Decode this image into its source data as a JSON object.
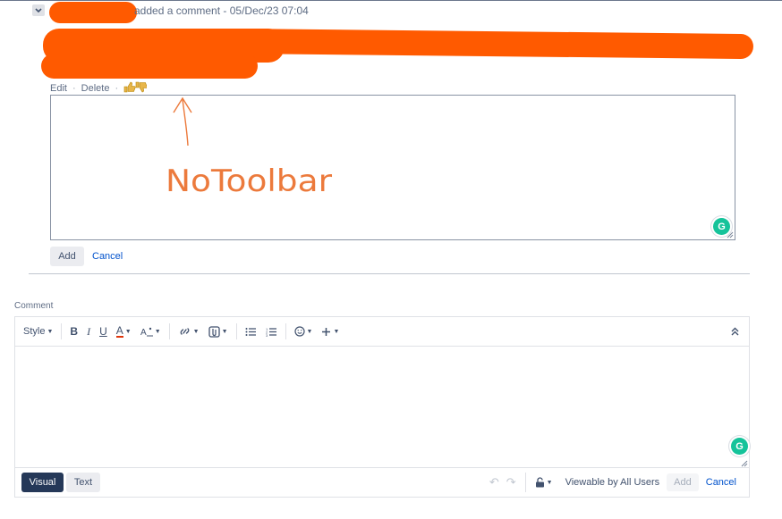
{
  "comment_header": {
    "meta": "added a comment - 05/Dec/23 07:04"
  },
  "comment_actions": {
    "edit": "Edit",
    "delete": "Delete",
    "separator": "·"
  },
  "annotation": {
    "text": "NoToolbar",
    "color": "#ec7a3c"
  },
  "reply_form": {
    "add_label": "Add",
    "cancel_label": "Cancel"
  },
  "comment_section": {
    "label": "Comment"
  },
  "toolbar": {
    "style_label": "Style",
    "bold": "B",
    "italic": "I",
    "underline": "U",
    "text_color": "A"
  },
  "footer": {
    "visual_label": "Visual",
    "text_label": "Text",
    "visibility": "Viewable by All Users",
    "add_label": "Add",
    "cancel_label": "Cancel"
  },
  "colors": {
    "redaction": "#ff5a00",
    "grammarly": "#15c39a",
    "primary_dark": "#253858",
    "link": "#0052cc"
  }
}
